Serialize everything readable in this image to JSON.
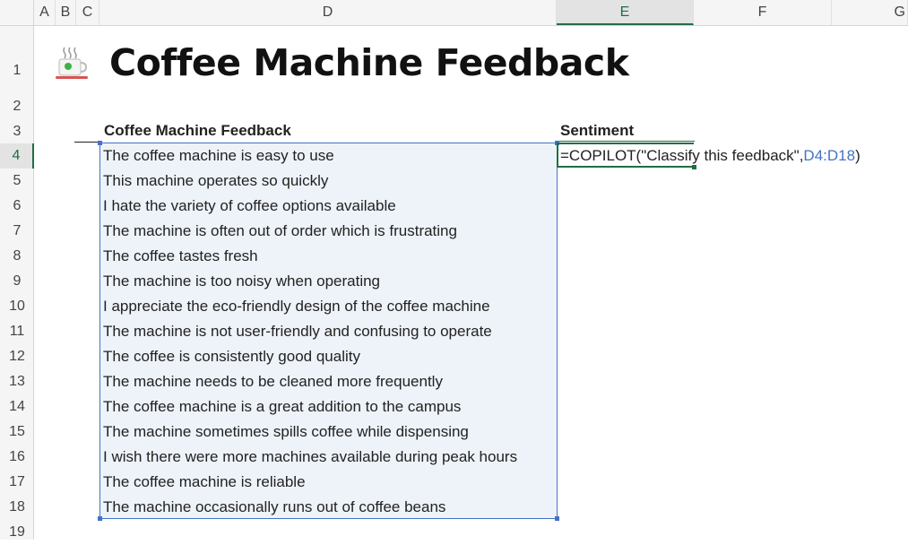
{
  "columns": [
    "A",
    "B",
    "C",
    "D",
    "E",
    "F",
    "G"
  ],
  "rows": [
    "1",
    "2",
    "3",
    "4",
    "5",
    "6",
    "7",
    "8",
    "9",
    "10",
    "11",
    "12",
    "13",
    "14",
    "15",
    "16",
    "17",
    "18",
    "19"
  ],
  "title": "Coffee Machine Feedback",
  "icon": "coffee-cup-icon",
  "headers": {
    "feedback": "Coffee Machine Feedback",
    "sentiment": "Sentiment"
  },
  "formula": {
    "prefix": "=COPILOT(\"Classify this feedback\",",
    "range": "D4:D18",
    "suffix": ")"
  },
  "feedback": [
    "The coffee machine is easy to use",
    "This machine operates so quickly",
    "I hate the variety of coffee options available",
    "The machine is often out of order which is frustrating",
    "The coffee tastes fresh",
    "The machine is too noisy when operating",
    "I appreciate the eco-friendly design of the coffee machine",
    "The machine is not user-friendly and confusing to operate",
    "The coffee is consistently good quality",
    "The machine needs to be cleaned more frequently",
    "The coffee machine is a great addition to the campus",
    "The machine sometimes spills coffee while dispensing",
    "I wish there were more machines available during peak hours",
    "The coffee machine is reliable",
    "The machine occasionally runs out of coffee beans"
  ],
  "colors": {
    "accent": "#1e6f42",
    "range_border": "#4472c4",
    "range_fill": "#eef3fa"
  }
}
